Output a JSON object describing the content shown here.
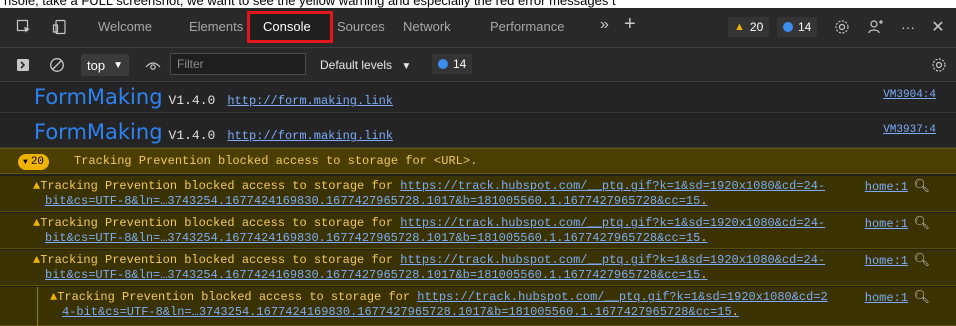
{
  "top_caption": "nsole, take a FULL screenshot, we want to see the yellow warning and especially the red error messages t",
  "tabs": [
    {
      "label": "Welcome"
    },
    {
      "label": "Elements"
    },
    {
      "label": "Console"
    },
    {
      "label": "Sources"
    },
    {
      "label": "Network"
    },
    {
      "label": "Performance"
    }
  ],
  "toolbar": {
    "more_tabs": "»",
    "add_tab": "+",
    "warn_count": "20",
    "info_count": "14",
    "more_menu": "···",
    "close": "✕"
  },
  "filterbar": {
    "context": "top",
    "filter_placeholder": "Filter",
    "levels": "Default levels",
    "levels_count": "14"
  },
  "colors": {
    "accent_blue": "#2d83f3",
    "warning_yellow": "#f0b400",
    "highlight_red": "#e4141b"
  },
  "logs": [
    {
      "title": "FormMaking",
      "version": "V1.4.0",
      "link": "http://form.making.link",
      "source": "VM3904:4"
    },
    {
      "title": "FormMaking",
      "version": "V1.4.0",
      "link": "http://form.making.link",
      "source": "VM3937:4"
    }
  ],
  "warning_group": {
    "count": "20",
    "message": "Tracking Prevention blocked access to storage for <URL>."
  },
  "warnings": [
    {
      "prefix": "Tracking Prevention blocked access to storage for ",
      "url_part1": "https://track.hubspot.com/__ptq.gif?k=1&sd=1920x1080&cd=24-",
      "url_part2": "bit&cs=UTF-8&ln=…3743254.1677424169830.1677427965728.1017&b=181005560.1.1677427965728&cc=15",
      "suffix": ".",
      "source": "home:1"
    },
    {
      "prefix": "Tracking Prevention blocked access to storage for ",
      "url_part1": "https://track.hubspot.com/__ptq.gif?k=1&sd=1920x1080&cd=24-",
      "url_part2": "bit&cs=UTF-8&ln=…3743254.1677424169830.1677427965728.1017&b=181005560.1.1677427965728&cc=15",
      "suffix": ".",
      "source": "home:1"
    },
    {
      "prefix": "Tracking Prevention blocked access to storage for ",
      "url_part1": "https://track.hubspot.com/__ptq.gif?k=1&sd=1920x1080&cd=24-",
      "url_part2": "bit&cs=UTF-8&ln=…3743254.1677424169830.1677427965728.1017&b=181005560.1.1677427965728&cc=15",
      "suffix": ".",
      "source": "home:1"
    },
    {
      "prefix": "Tracking Prevention blocked access to storage for ",
      "url_part1": "https://track.hubspot.com/__ptq.gif?k=1&sd=1920x1080&cd=2",
      "url_part2": "4-bit&cs=UTF-8&ln=…3743254.1677424169830.1677427965728.1017&b=181005560.1.1677427965728&cc=15",
      "suffix": ".",
      "source": "home:1"
    }
  ]
}
